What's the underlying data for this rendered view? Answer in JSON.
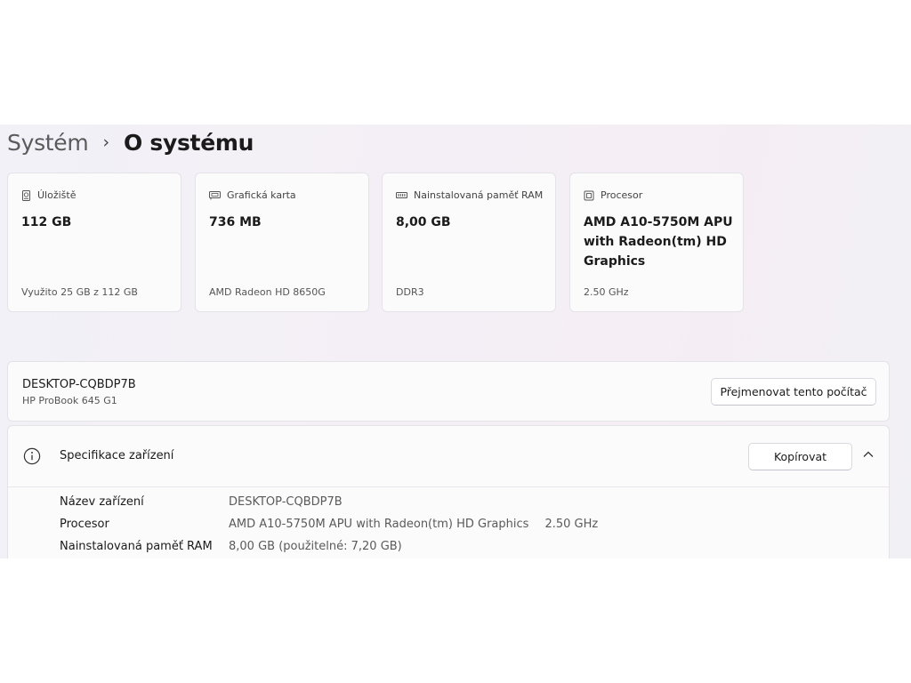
{
  "breadcrumb": {
    "parent": "Systém",
    "separator": "›",
    "current": "O systému"
  },
  "cards": [
    {
      "icon": "storage-icon",
      "label": "Úložiště",
      "value": "112 GB",
      "detail": "Využito 25 GB z 112 GB"
    },
    {
      "icon": "graphics-card-icon",
      "label": "Grafická karta",
      "value": "736 MB",
      "detail": "AMD Radeon HD 8650G"
    },
    {
      "icon": "memory-icon",
      "label": "Nainstalovaná paměť RAM",
      "value": "8,00 GB",
      "detail": "DDR3"
    },
    {
      "icon": "processor-icon",
      "label": "Procesor",
      "value": "AMD A10-5750M APU with Radeon(tm) HD Graphics",
      "detail": "2.50 GHz"
    }
  ],
  "device": {
    "name": "DESKTOP-CQBDP7B",
    "model": "HP ProBook 645 G1",
    "rename_label": "Přejmenovat tento počítač"
  },
  "specs": {
    "title": "Specifikace zařízení",
    "copy_label": "Kopírovat",
    "rows": [
      {
        "label": "Název zařízení",
        "value": "DESKTOP-CQBDP7B",
        "extra": ""
      },
      {
        "label": "Procesor",
        "value": "AMD A10-5750M APU with Radeon(tm) HD Graphics",
        "extra": "2.50 GHz"
      },
      {
        "label": "Nainstalovaná paměť RAM",
        "value": "8,00 GB (použitelné: 7,20 GB)",
        "extra": ""
      }
    ]
  }
}
